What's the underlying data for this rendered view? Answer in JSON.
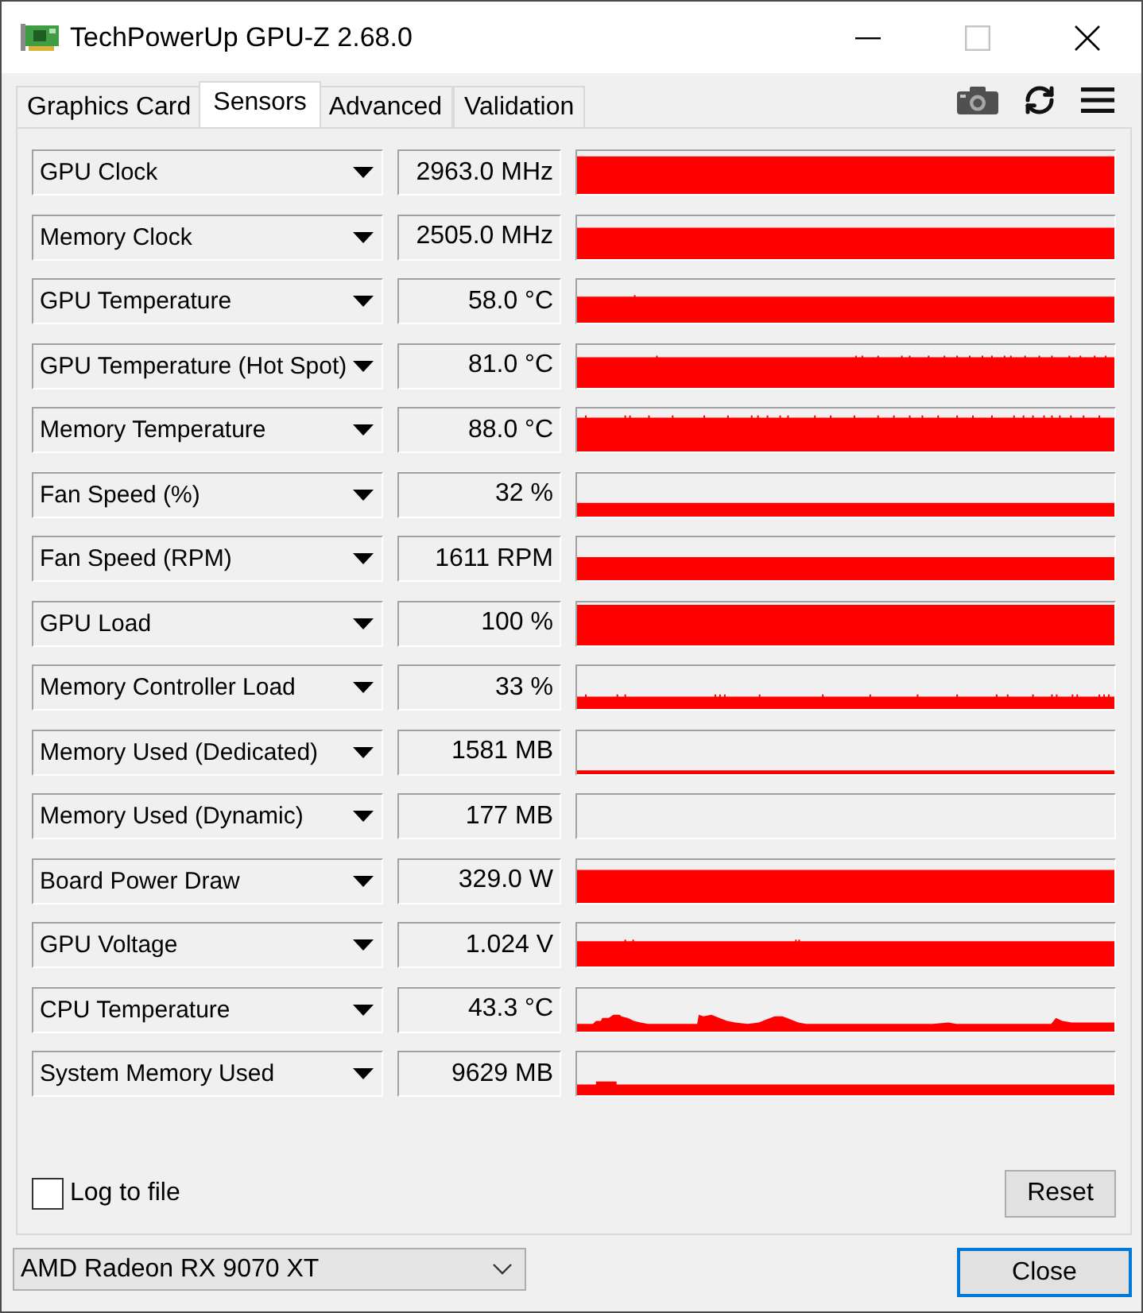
{
  "window": {
    "title": "TechPowerUp GPU-Z 2.68.0"
  },
  "tabs": [
    {
      "label": "Graphics Card",
      "selected": false
    },
    {
      "label": "Sensors",
      "selected": true
    },
    {
      "label": "Advanced",
      "selected": false
    },
    {
      "label": "Validation",
      "selected": false
    }
  ],
  "sensors": [
    {
      "name": "GPU Clock",
      "value": "2963.0 MHz"
    },
    {
      "name": "Memory Clock",
      "value": "2505.0 MHz"
    },
    {
      "name": "GPU Temperature",
      "value": "58.0 °C"
    },
    {
      "name": "GPU Temperature (Hot Spot)",
      "value": "81.0 °C"
    },
    {
      "name": "Memory Temperature",
      "value": "88.0 °C"
    },
    {
      "name": "Fan Speed (%)",
      "value": "32 %"
    },
    {
      "name": "Fan Speed (RPM)",
      "value": "1611 RPM"
    },
    {
      "name": "GPU Load",
      "value": "100 %"
    },
    {
      "name": "Memory Controller Load",
      "value": "33 %"
    },
    {
      "name": "Memory Used (Dedicated)",
      "value": "1581 MB"
    },
    {
      "name": "Memory Used (Dynamic)",
      "value": "177 MB"
    },
    {
      "name": "Board Power Draw",
      "value": "329.0 W"
    },
    {
      "name": "GPU Voltage",
      "value": "1.024 V"
    },
    {
      "name": "CPU Temperature",
      "value": "43.3 °C"
    },
    {
      "name": "System Memory Used",
      "value": "9629 MB"
    }
  ],
  "log_to_file": {
    "label": "Log to file",
    "checked": false
  },
  "reset_button": "Reset",
  "gpu_select": {
    "value": "AMD Radeon RX 9070 XT"
  },
  "close_button": "Close"
}
